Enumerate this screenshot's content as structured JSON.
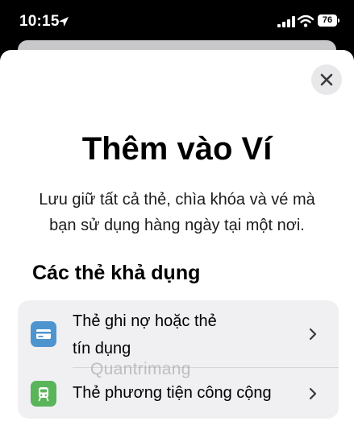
{
  "status_bar": {
    "time": "10:15",
    "battery": "76",
    "icons": [
      "location-arrow-icon",
      "signal-icon",
      "wifi-icon",
      "battery-icon"
    ]
  },
  "sheet": {
    "title": "Thêm vào Ví",
    "subtitle_line1": "Lưu giữ tất cả thẻ, chìa khóa và vé mà",
    "subtitle_line2": "bạn sử dụng hàng ngày tại một nơi.",
    "section_title": "Các thẻ khả dụng",
    "items": [
      {
        "label_line1": "Thẻ ghi nợ hoặc thẻ",
        "label_line2": "tín dụng",
        "icon": "credit-card-icon",
        "icon_color": "#4e95d0"
      },
      {
        "label": "Thẻ phương tiện công cộng",
        "icon": "train-icon",
        "icon_color": "#5ab55a"
      }
    ]
  },
  "watermark": "Quantrimang",
  "colors": {
    "status_bar_bg": "#000000",
    "sheet_bg": "#ffffff",
    "list_bg": "#f0f0f3",
    "chevron": "#3a3a3c"
  }
}
